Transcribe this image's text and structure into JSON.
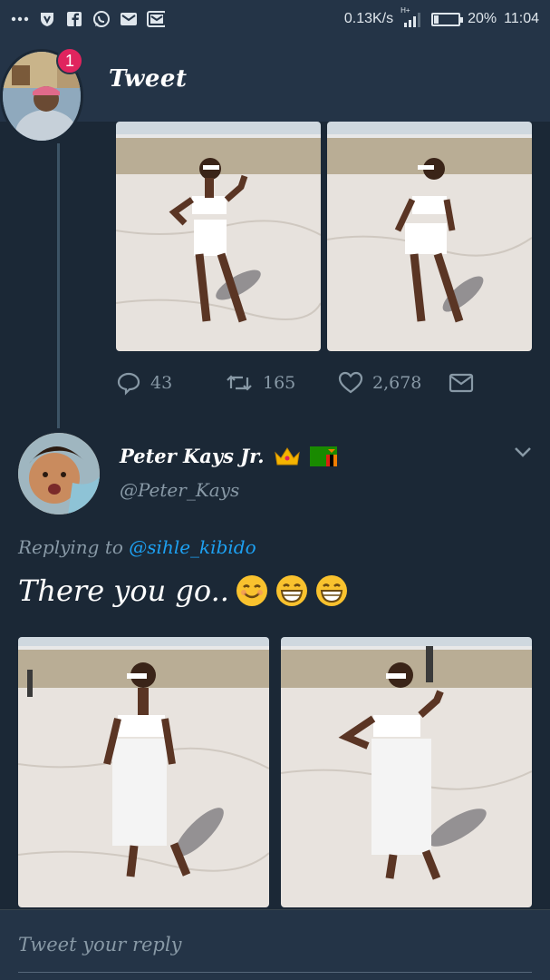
{
  "status_bar": {
    "left_icons": [
      "more-icon",
      "vpn-icon",
      "facebook-icon",
      "whatsapp-icon",
      "gmail-icon",
      "gmail-icon"
    ],
    "network_speed": "0.13K/s",
    "network_type": "H+",
    "battery": "20%",
    "battery_level": 0.2,
    "time": "11:04"
  },
  "header": {
    "title": "Tweet",
    "notification_count": "1"
  },
  "tweet_actions": {
    "replies": "43",
    "retweets": "165",
    "likes": "2,678"
  },
  "reply": {
    "name": "Peter Kays Jr.",
    "name_emojis": [
      "crown-emoji",
      "zambia-flag-emoji"
    ],
    "handle": "@Peter_Kays",
    "replying_prefix": "Replying to",
    "replying_to": "@sihle_kibido",
    "text": "There you go..",
    "text_emojis": [
      "smiling-face-emoji",
      "grinning-face-emoji",
      "grinning-face-emoji"
    ]
  },
  "composer": {
    "placeholder": "Tweet your reply"
  },
  "colors": {
    "background": "#1b2836",
    "header": "#243447",
    "muted": "#8899a6",
    "link": "#1da1f2",
    "badge": "#e0245e"
  }
}
